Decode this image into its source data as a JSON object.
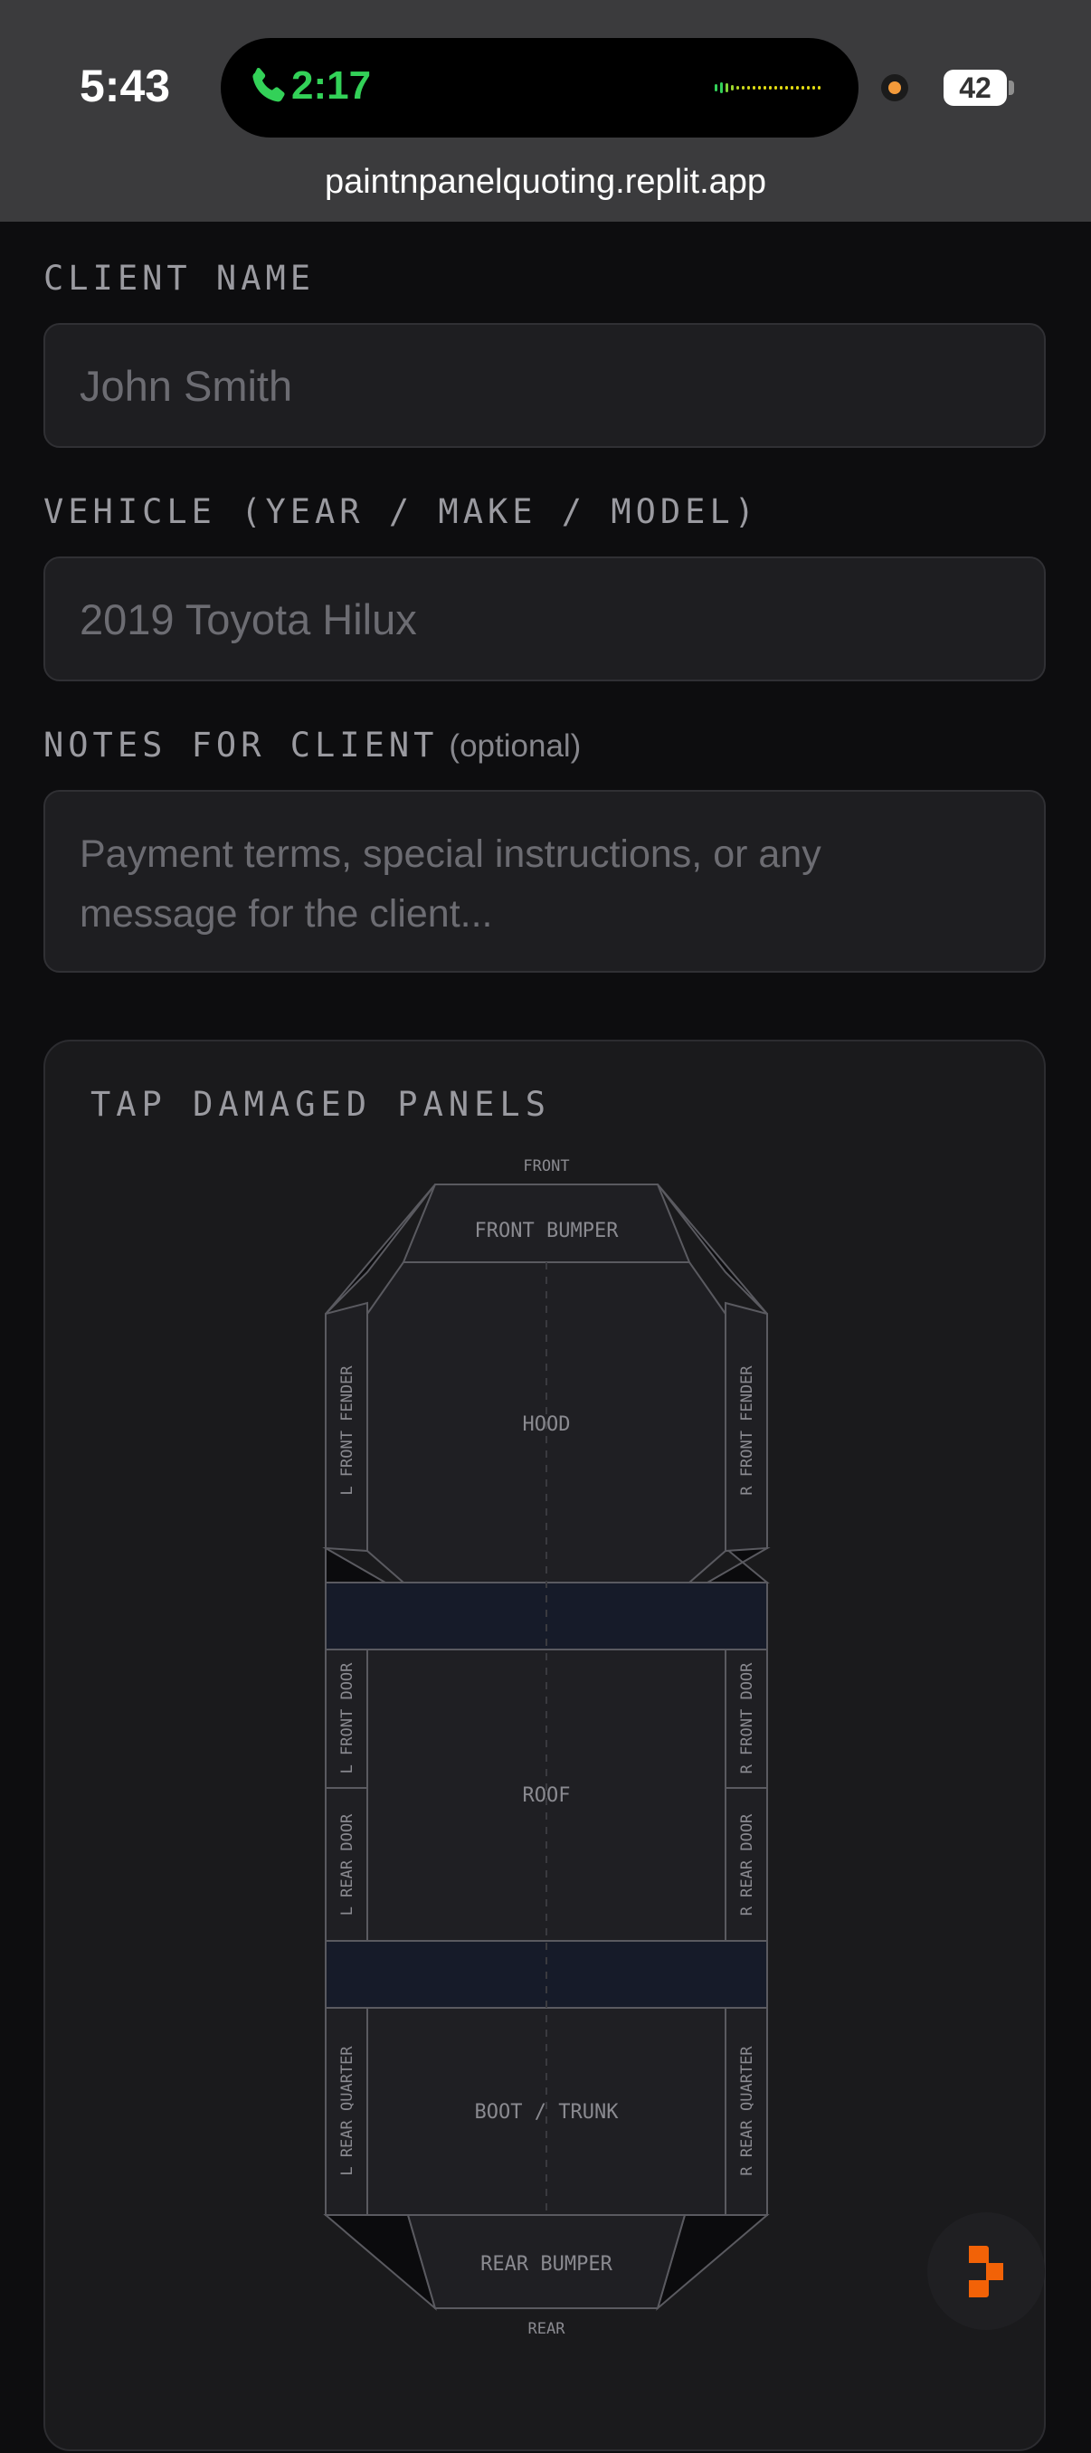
{
  "status": {
    "time": "5:43",
    "call_timer": "2:17",
    "battery": "42",
    "icons": [
      "phone-icon",
      "audio-wave-icon",
      "recording-dot-icon",
      "battery-icon"
    ],
    "url": "paintnpanelquoting.replit.app"
  },
  "form": {
    "client_name": {
      "label": "CLIENT NAME",
      "placeholder": "John Smith"
    },
    "vehicle": {
      "label": "VEHICLE (YEAR / MAKE / MODEL)",
      "placeholder": "2019 Toyota Hilux"
    },
    "notes": {
      "label": "NOTES FOR CLIENT",
      "optional": "(optional)",
      "placeholder_line1": "Payment terms, special instructions, or any",
      "placeholder_line2": "message for the client..."
    }
  },
  "panels": {
    "title": "TAP DAMAGED PANELS",
    "front": "FRONT",
    "rear": "REAR",
    "labels": {
      "front_bumper": "FRONT BUMPER",
      "hood": "HOOD",
      "l_front_fender": "L FRONT FENDER",
      "r_front_fender": "R FRONT FENDER",
      "roof": "ROOF",
      "l_front_door": "L FRONT DOOR",
      "r_front_door": "R FRONT DOOR",
      "l_rear_door": "L REAR DOOR",
      "r_rear_door": "R REAR DOOR",
      "boot": "BOOT / TRUNK",
      "l_rear_quarter": "L REAR QUARTER",
      "r_rear_quarter": "R REAR QUARTER",
      "rear_bumper": "REAR BUMPER"
    }
  },
  "fab": {
    "icon": "replit-logo-icon"
  },
  "colors": {
    "background": "#0d0d0f",
    "card": "#1a1a1c",
    "panel_fill": "#1f1f23",
    "panel_stroke": "#5a5a60",
    "glass": "#161b29",
    "call_green": "#33d158",
    "replit_orange": "#f26207"
  }
}
